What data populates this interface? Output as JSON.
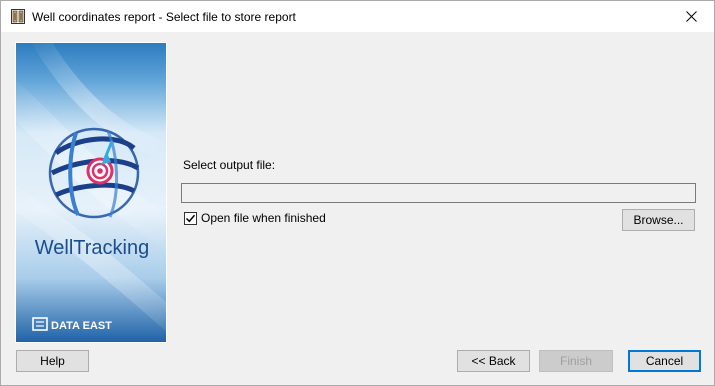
{
  "window": {
    "title": "Well coordinates report - Select file to store report",
    "close_glyph": "✕"
  },
  "banner": {
    "product_name": "WellTracking",
    "company": "DATA EAST",
    "icons": [
      "globe-target-logo",
      "data-east-logo"
    ],
    "colors": {
      "top": "#2d7cc0",
      "light": "#cde4f5",
      "bottom": "#1c5fa5",
      "text": "#1b4d8c"
    }
  },
  "form": {
    "prompt": "Select output file:",
    "output_path": "",
    "open_when_finished_label": "Open file when finished",
    "open_when_finished_checked": true,
    "browse_label": "Browse..."
  },
  "buttons": {
    "help": "Help",
    "back": "<< Back",
    "finish": "Finish",
    "cancel": "Cancel"
  }
}
